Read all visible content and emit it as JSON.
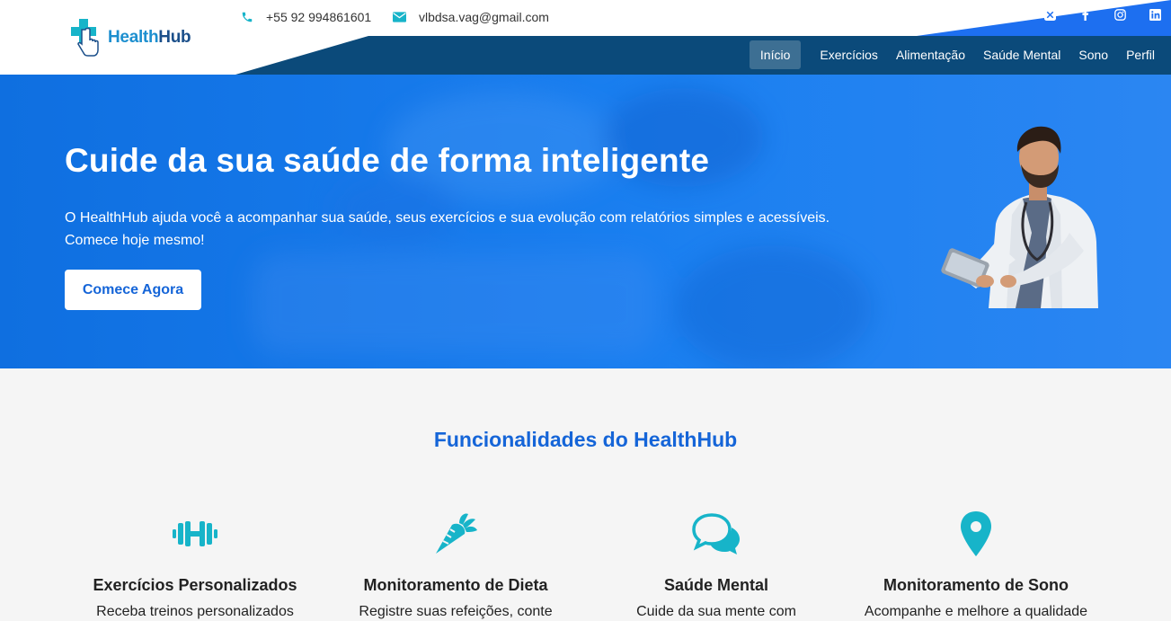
{
  "brand": {
    "name_part1": "Health",
    "name_part2": "Hub"
  },
  "contact": {
    "phone": "+55 92 994861601",
    "email": "vlbdsa.vag@gmail.com"
  },
  "socials": [
    "x-icon",
    "facebook-icon",
    "instagram-icon",
    "linkedin-icon"
  ],
  "nav": {
    "items": [
      {
        "label": "Início"
      },
      {
        "label": "Exercícios"
      },
      {
        "label": "Alimentação"
      },
      {
        "label": "Saúde Mental"
      },
      {
        "label": "Sono"
      },
      {
        "label": "Perfil"
      }
    ],
    "active": "Início"
  },
  "hero": {
    "title": "Cuide da sua saúde de forma inteligente",
    "description": "O HealthHub ajuda você a acompanhar sua saúde, seus exercícios e sua evolução com relatórios simples e acessíveis. Comece hoje mesmo!",
    "cta": "Comece Agora"
  },
  "features": {
    "title": "Funcionalidades do HealthHub",
    "items": [
      {
        "icon": "dumbbell-icon",
        "title": "Exercícios Personalizados",
        "desc": "Receba treinos personalizados"
      },
      {
        "icon": "carrot-icon",
        "title": "Monitoramento de Dieta",
        "desc": "Registre suas refeições, conte"
      },
      {
        "icon": "chat-bubbles-icon",
        "title": "Saúde Mental",
        "desc": "Cuide da sua mente com"
      },
      {
        "icon": "location-pin-icon",
        "title": "Monitoramento de Sono",
        "desc": "Acompanhe e melhore a qualidade"
      }
    ]
  },
  "colors": {
    "primary": "#1565d8",
    "navy": "#0b4a7a",
    "teal": "#17b4c9",
    "accent_blue": "#1d6ff0"
  }
}
